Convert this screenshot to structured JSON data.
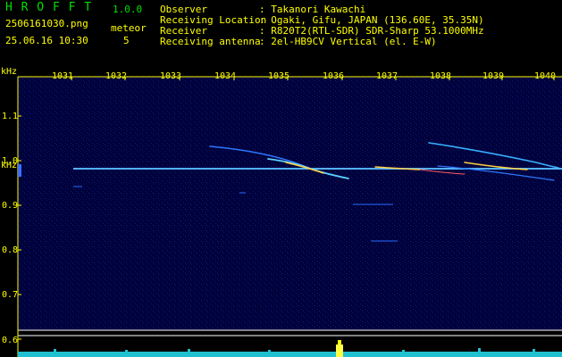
{
  "header": {
    "app_title": "H R O F F T",
    "version": "1.0.0",
    "filename": "2506161030.png",
    "datetime": "25.06.16 10:30",
    "meteor_label": "meteor",
    "meteor_count": "5",
    "info": [
      {
        "label": "Observer",
        "value": ": Takanori Kawachi"
      },
      {
        "label": "Receiving Location",
        "value": ": Ogaki, Gifu, JAPAN (136.60E, 35.35N)"
      },
      {
        "label": "Receiver",
        "value": ": R820T2(RTL-SDR) SDR-Sharp 53.1000MHz"
      },
      {
        "label": "Receiving antenna",
        "value": ": 2el-HB9CV Vertical (el. E-W)"
      }
    ]
  },
  "spectrogram": {
    "unit_label": "kHz",
    "time_ticks": [
      "1031",
      "1032",
      "1033",
      "1034",
      "1035",
      "1036",
      "1037",
      "1038",
      "1039",
      "1040"
    ],
    "freq_ticks": [
      "1.1",
      "1.0",
      "0.9",
      "0.8",
      "0.7",
      "0.6"
    ],
    "colors": {
      "background": "#00003c",
      "trace": "#3fa0ff",
      "echo": "#ffd040",
      "axis": "#ffff00"
    }
  }
}
